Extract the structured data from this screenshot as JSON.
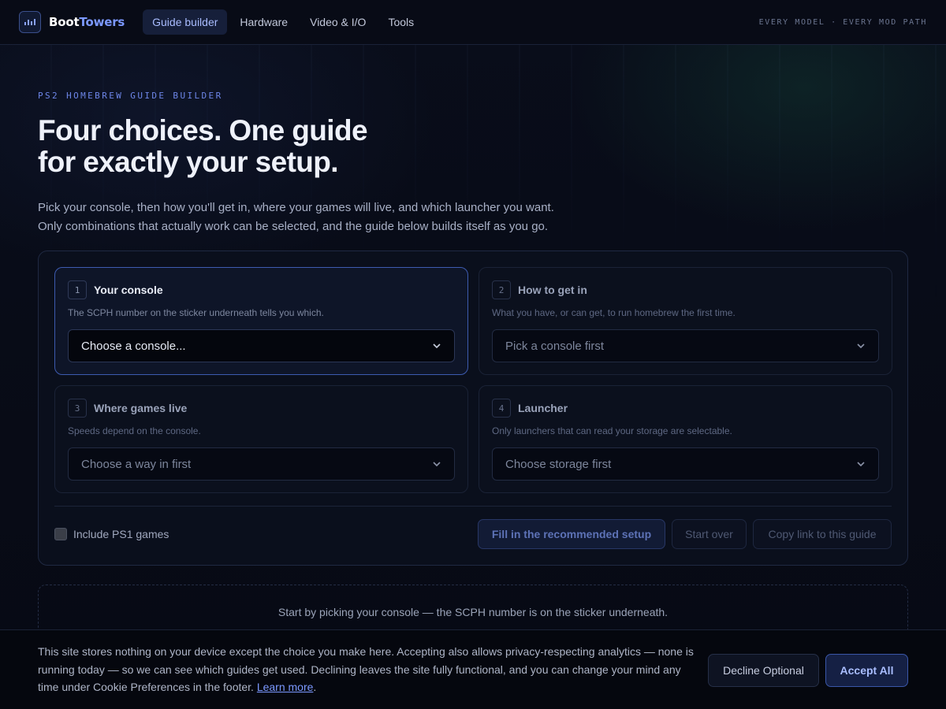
{
  "nav": {
    "brand_part1": "Boot",
    "brand_part2": "Towers",
    "links": [
      "Guide builder",
      "Hardware",
      "Video & I/O",
      "Tools"
    ],
    "active_link": "Guide builder",
    "tagline": "EVERY MODEL · EVERY MOD PATH",
    "logo_icon": "bar-chart-icon"
  },
  "hero": {
    "eyebrow": "PS2 HOMEBREW GUIDE BUILDER",
    "headline_line1": "Four choices. One guide",
    "headline_line2": "for exactly your setup.",
    "sub_line1": "Pick your console, then how you'll get in, where your games will live, and which launcher you want.",
    "sub_line2": "Only combinations that actually work can be selected, and the guide below builds itself as you go."
  },
  "steps": [
    {
      "num": "1",
      "title": "Your console",
      "desc": "The SCPH number on the sticker underneath tells you which.",
      "select_value": "Choose a console...",
      "active": true
    },
    {
      "num": "2",
      "title": "How to get in",
      "desc": "What you have, or can get, to run homebrew the first time.",
      "select_value": "Pick a console first",
      "active": false
    },
    {
      "num": "3",
      "title": "Where games live",
      "desc": "Speeds depend on the console.",
      "select_value": "Choose a way in first",
      "active": false
    },
    {
      "num": "4",
      "title": "Launcher",
      "desc": "Only launchers that can read your storage are selectable.",
      "select_value": "Choose storage first",
      "active": false
    }
  ],
  "options": {
    "ps1_label": "Include PS1 games",
    "ps1_checked": false
  },
  "actions": {
    "fill": "Fill in the recommended setup",
    "reset": "Start over",
    "copy": "Copy link to this guide"
  },
  "hint": "Start by picking your console — the SCPH number is on the sticker underneath.",
  "cookie": {
    "text": "This site stores nothing on your device except the choice you make here. Accepting also allows privacy-respecting analytics — none is running today — so we can see which guides get used. Declining leaves the site fully functional, and you can change your mind any time under Cookie Preferences in the footer.",
    "link": "Learn more",
    "after_link": ".",
    "decline": "Decline Optional",
    "accept": "Accept All"
  },
  "colors": {
    "accent": "#7b98ff",
    "background": "#070a14",
    "active_border": "#3d5bb0"
  }
}
